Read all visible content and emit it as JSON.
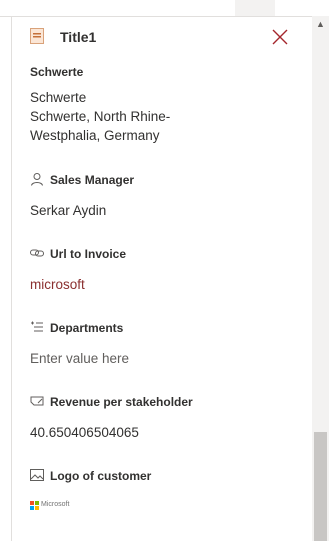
{
  "header": {
    "title": "Title1",
    "close_icon": "close-icon",
    "record_icon": "document-icon"
  },
  "colors": {
    "accent": "#a4262c",
    "link": "#8a2f2f",
    "text": "#323130",
    "muted": "#605e5c"
  },
  "fields": {
    "location": {
      "label": "Schwerte",
      "line1": "Schwerte",
      "line2": "Schwerte, North Rhine-",
      "line3": "Westphalia, Germany"
    },
    "sales_manager": {
      "label": "Sales Manager",
      "icon": "person-icon",
      "value": "Serkar Aydin"
    },
    "url_invoice": {
      "label": "Url to Invoice",
      "icon": "link-icon",
      "value": "microsoft"
    },
    "departments": {
      "label": "Departments",
      "icon": "choice-list-icon",
      "placeholder": "Enter value here"
    },
    "revenue": {
      "label": "Revenue per stakeholder",
      "icon": "edit-number-icon",
      "value": "40.650406504065"
    },
    "logo": {
      "label": "Logo of customer",
      "icon": "image-icon",
      "logo_text": "Microsoft"
    }
  }
}
